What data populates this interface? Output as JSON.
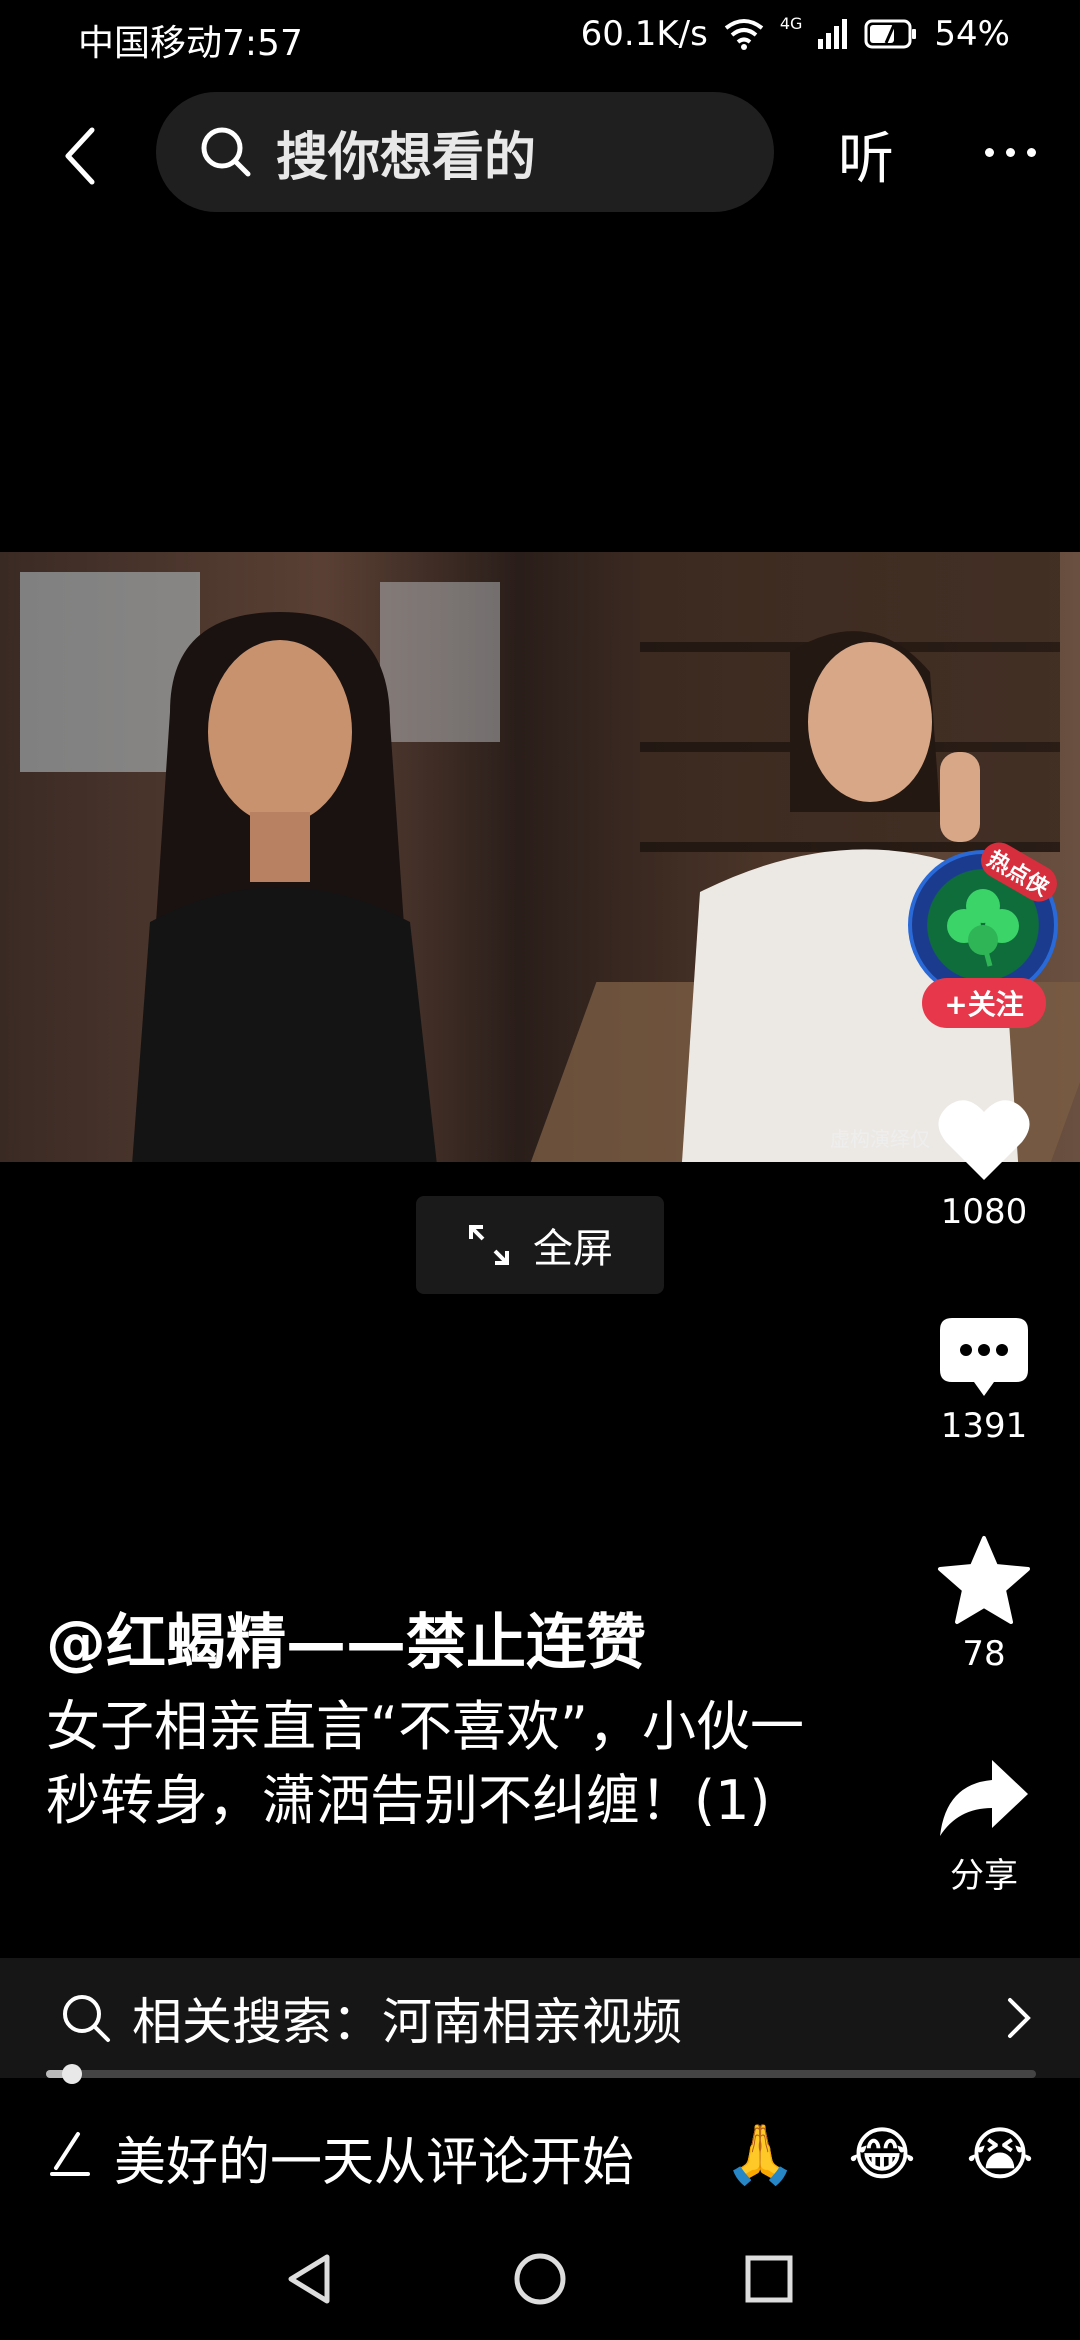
{
  "status_bar": {
    "carrier_time": "中国移动7:57",
    "net_speed": "60.1K/s",
    "network": "4G",
    "battery": "54%"
  },
  "top_bar": {
    "search_placeholder": "搜你想看的",
    "listen_label": "听"
  },
  "video": {
    "watermark": "虚构演绎仅"
  },
  "fullscreen": {
    "label": "全屏"
  },
  "creator": {
    "badge": "热点侠",
    "follow_label": "+关注"
  },
  "actions": {
    "likes": "1080",
    "comments": "1391",
    "favorites": "78",
    "share_label": "分享"
  },
  "post": {
    "author": "@红蝎精——禁止连赞",
    "caption": "女子相亲直言“不喜欢”，小伙一秒转身，潇洒告别不纠缠！(1)"
  },
  "related_search": {
    "text": "相关搜索：河南相亲视频"
  },
  "playback": {
    "progress_percent": 2
  },
  "comment_bar": {
    "placeholder": "美好的一天从评论开始",
    "emojis": [
      "🙏",
      "😂",
      "😭"
    ]
  },
  "colors": {
    "accent_red": "#e7384b",
    "background": "#000000",
    "search_bg": "#1f1f1f"
  }
}
